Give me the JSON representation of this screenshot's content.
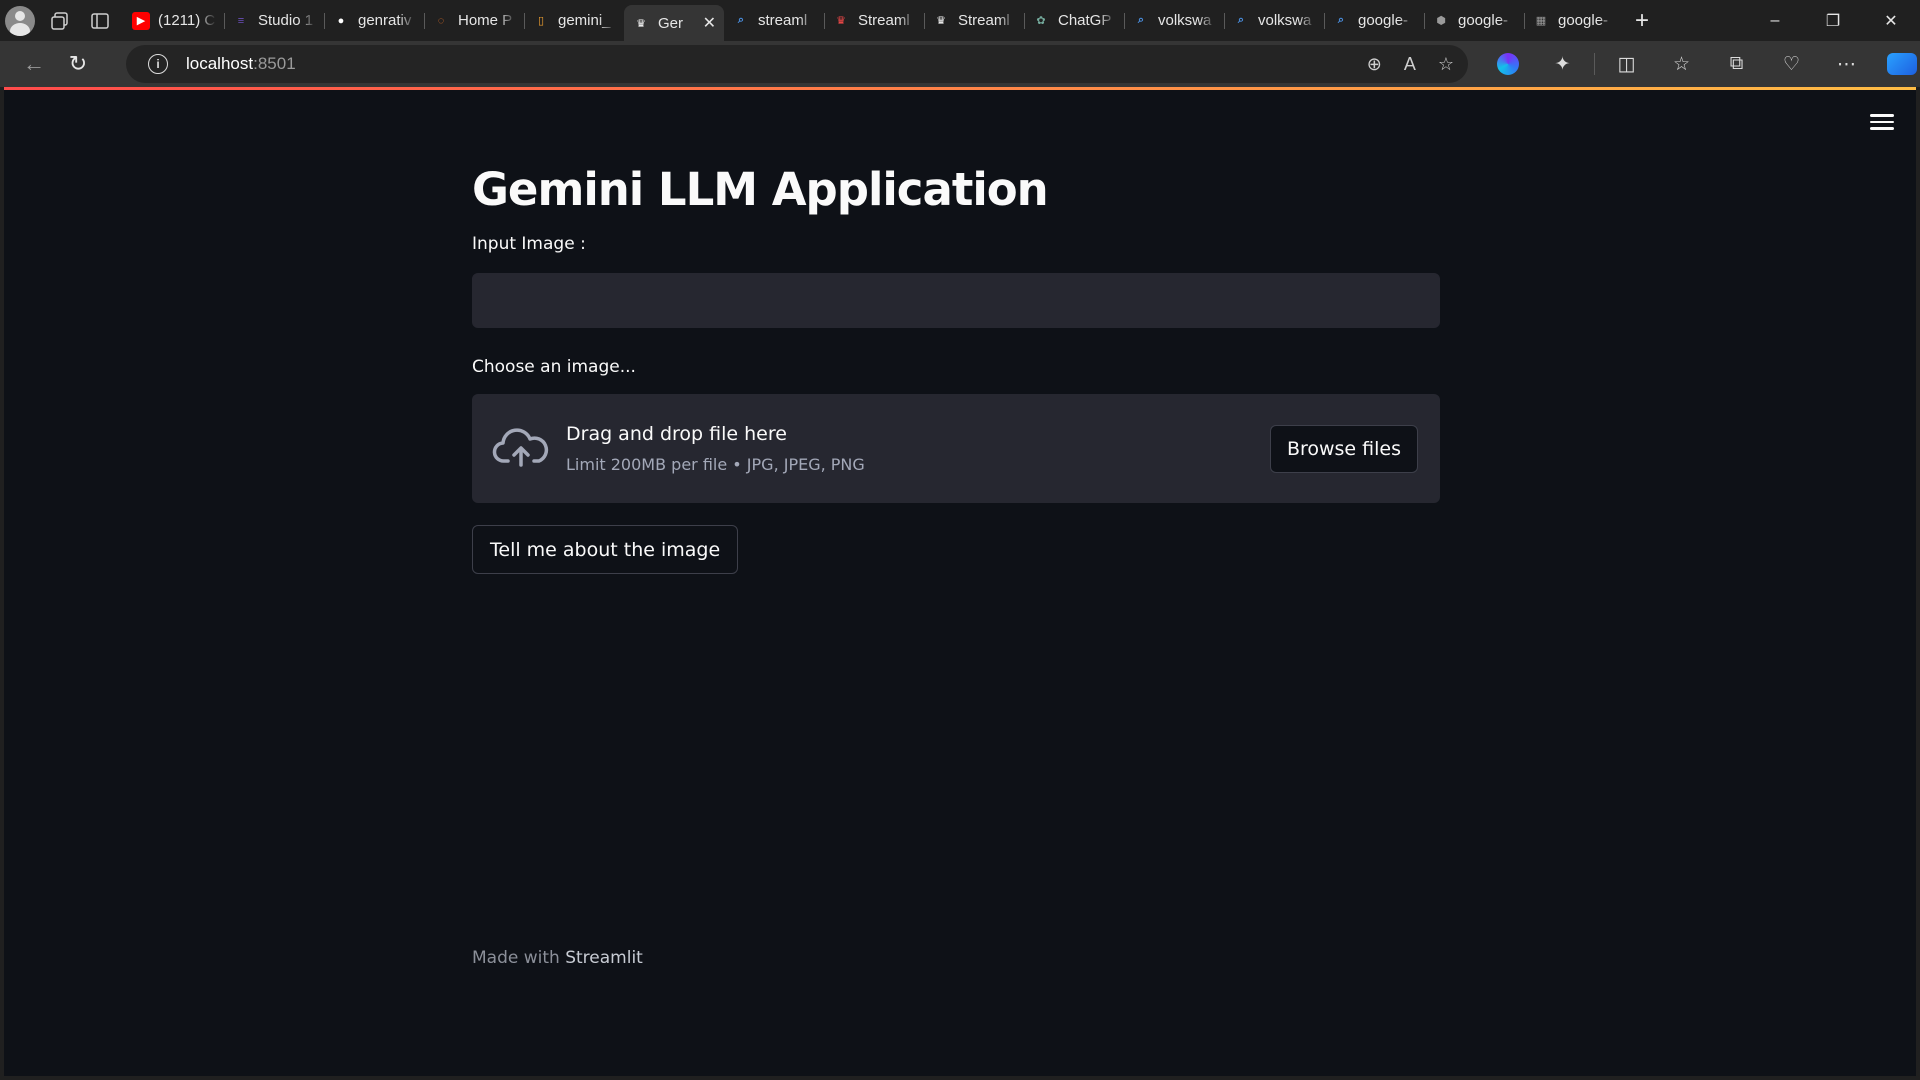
{
  "browser": {
    "tabs": [
      {
        "label": "(1211) C",
        "favicon": "youtube-icon",
        "color": "#ff0000"
      },
      {
        "label": "Studio 1",
        "favicon": "list-icon",
        "color": "#6b4fbb"
      },
      {
        "label": "genrativ",
        "favicon": "github-icon",
        "color": "#ffffff"
      },
      {
        "label": "Home P",
        "favicon": "jupyter-icon",
        "color": "#f37626"
      },
      {
        "label": "gemini_",
        "favicon": "file-icon",
        "color": "#f0a030"
      },
      {
        "label": "Ger",
        "favicon": "streamlit-icon",
        "color": "#ffffff",
        "active": true
      },
      {
        "label": "streaml",
        "favicon": "search-icon",
        "color": "#4a90e2"
      },
      {
        "label": "Streaml",
        "favicon": "streamlit-icon",
        "color": "#ff4b4b"
      },
      {
        "label": "Streaml",
        "favicon": "streamlit-icon",
        "color": "#ffffff"
      },
      {
        "label": "ChatGP",
        "favicon": "chatgpt-icon",
        "color": "#74aa9c"
      },
      {
        "label": "volkswa",
        "favicon": "search-icon",
        "color": "#4a90e2"
      },
      {
        "label": "volkswa",
        "favicon": "search-icon",
        "color": "#4a90e2"
      },
      {
        "label": "google-",
        "favicon": "search-icon",
        "color": "#4a90e2"
      },
      {
        "label": "google-",
        "favicon": "kaggle-icon",
        "color": "#9a9a9a"
      },
      {
        "label": "google-",
        "favicon": "huggingface-icon",
        "color": "#9a9a9a"
      }
    ],
    "url_host": "localhost",
    "url_port": ":8501"
  },
  "app": {
    "title": "Gemini LLM Application",
    "input_label": "Input Image :",
    "input_value": "",
    "uploader_label": "Choose an image...",
    "dropzone_title": "Drag and drop file here",
    "dropzone_limit": "Limit 200MB per file • JPG, JPEG, PNG",
    "browse_label": "Browse files",
    "submit_label": "Tell me about the image",
    "footer_prefix": "Made with ",
    "footer_brand": "Streamlit"
  }
}
